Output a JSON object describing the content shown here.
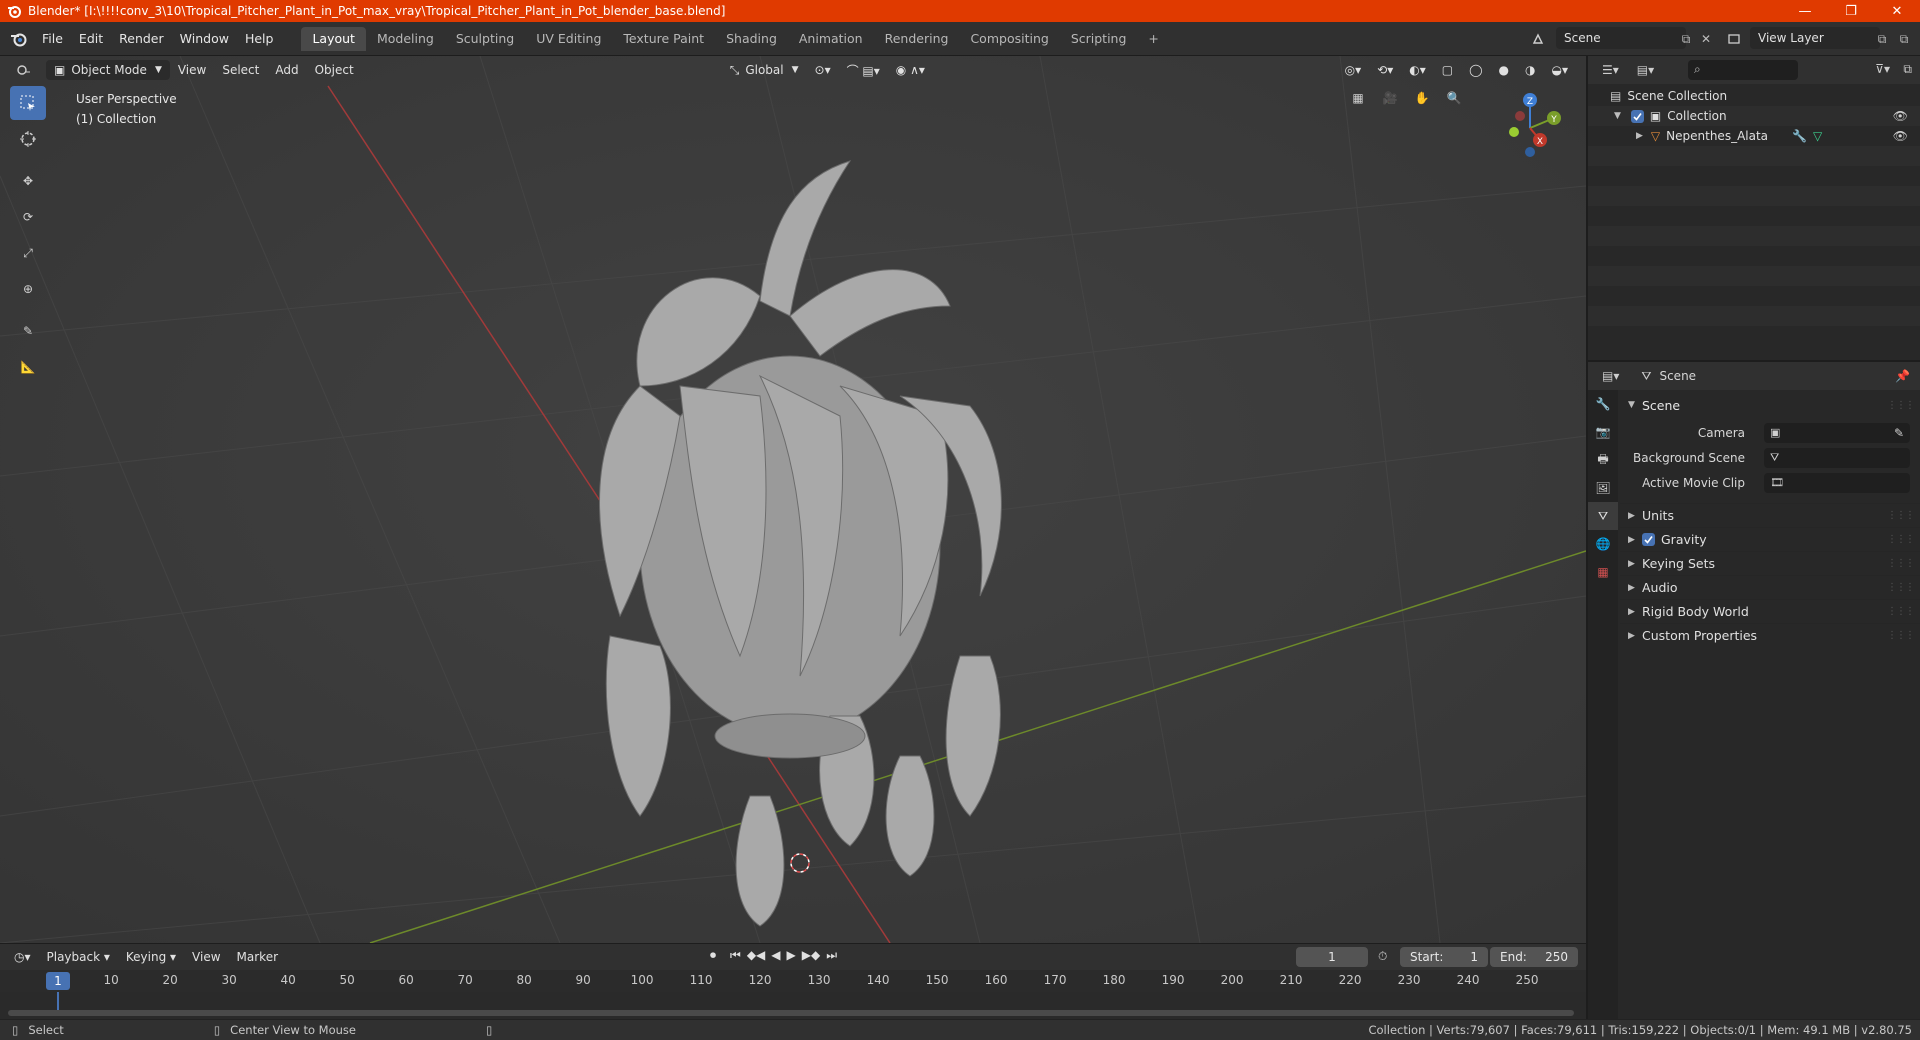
{
  "window": {
    "title": "Blender* [I:\\!!!!conv_3\\10\\Tropical_Pitcher_Plant_in_Pot_max_vray\\Tropical_Pitcher_Plant_in_Pot_blender_base.blend]",
    "minimize": "—",
    "maximize": "❐",
    "close": "✕"
  },
  "menu": [
    "File",
    "Edit",
    "Render",
    "Window",
    "Help"
  ],
  "workspaces": [
    "Layout",
    "Modeling",
    "Sculpting",
    "UV Editing",
    "Texture Paint",
    "Shading",
    "Animation",
    "Rendering",
    "Compositing",
    "Scripting"
  ],
  "add_workspace": "+",
  "scene_name": "Scene",
  "view_layer": "View Layer",
  "viewport": {
    "mode": "Object Mode",
    "menus": [
      "View",
      "Select",
      "Add",
      "Object"
    ],
    "transform_orientation": "Global",
    "perspective_label": "User Perspective",
    "collection_label": "(1) Collection",
    "axes": {
      "z": "Z",
      "y": "Y",
      "x": "X"
    }
  },
  "timeline": {
    "menus": [
      "Playback",
      "Keying",
      "View",
      "Marker"
    ],
    "current_frame": "1",
    "start_label": "Start:",
    "start": "1",
    "end_label": "End:",
    "end": "250",
    "ruler_ticks": [
      "1",
      "10",
      "20",
      "30",
      "40",
      "50",
      "60",
      "70",
      "80",
      "90",
      "100",
      "110",
      "120",
      "130",
      "140",
      "150",
      "160",
      "170",
      "180",
      "190",
      "200",
      "210",
      "220",
      "230",
      "240",
      "250"
    ]
  },
  "statusbar": {
    "select": "Select",
    "center_view": "Center View to Mouse",
    "stats": "Collection | Verts:79,607 | Faces:79,611 | Tris:159,222 | Objects:0/1 | Mem: 49.1 MB | v2.80.75"
  },
  "outliner": {
    "root": "Scene Collection",
    "collection": "Collection",
    "object": "Nepenthes_Alata"
  },
  "properties": {
    "header": "Scene",
    "panel": "Scene",
    "camera_label": "Camera",
    "background_scene_label": "Background Scene",
    "active_movie_clip_label": "Active Movie Clip",
    "subpanels": [
      "Units",
      "Gravity",
      "Keying Sets",
      "Audio",
      "Rigid Body World",
      "Custom Properties"
    ]
  },
  "colors": {
    "title_bar": "#e03a00",
    "accent": "#4772b3",
    "x_axis": "#c0392b",
    "y_axis": "#7a9e2a",
    "z_axis": "#3f7fd6"
  }
}
